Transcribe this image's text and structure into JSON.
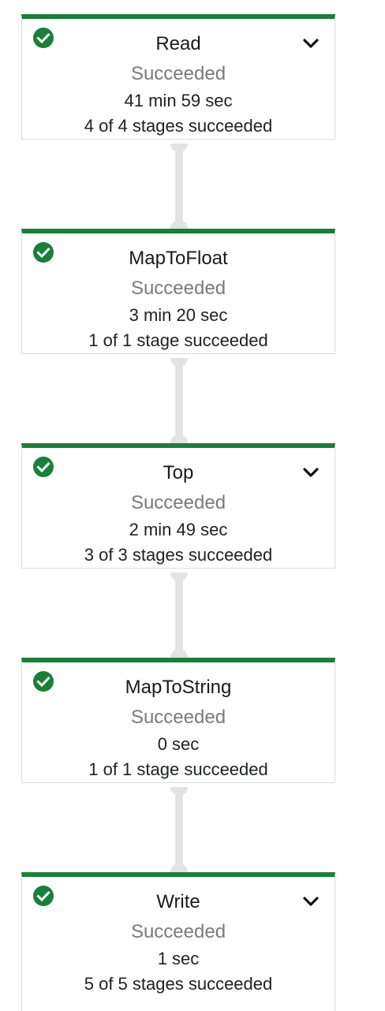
{
  "steps": [
    {
      "name": "Read",
      "status": "Succeeded",
      "duration": "41 min 59 sec",
      "stages": "4 of 4 stages succeeded",
      "expandable": true,
      "status_icon": "check-circle-icon",
      "expand_icon": "chevron-down-icon"
    },
    {
      "name": "MapToFloat",
      "status": "Succeeded",
      "duration": "3 min 20 sec",
      "stages": "1 of 1 stage succeeded",
      "expandable": false,
      "status_icon": "check-circle-icon"
    },
    {
      "name": "Top",
      "status": "Succeeded",
      "duration": "2 min 49 sec",
      "stages": "3 of 3 stages succeeded",
      "expandable": true,
      "status_icon": "check-circle-icon",
      "expand_icon": "chevron-down-icon"
    },
    {
      "name": "MapToString",
      "status": "Succeeded",
      "duration": "0 sec",
      "stages": "1 of 1 stage succeeded",
      "expandable": false,
      "status_icon": "check-circle-icon"
    },
    {
      "name": "Write",
      "status": "Succeeded",
      "duration": "1 sec",
      "stages": "5 of 5 stages succeeded",
      "expandable": true,
      "status_icon": "check-circle-icon",
      "expand_icon": "chevron-down-icon"
    }
  ],
  "colors": {
    "success": "#188038",
    "connector": "#e3e3e3",
    "status_text": "#7a7a7a",
    "card_border": "#dadce0"
  }
}
